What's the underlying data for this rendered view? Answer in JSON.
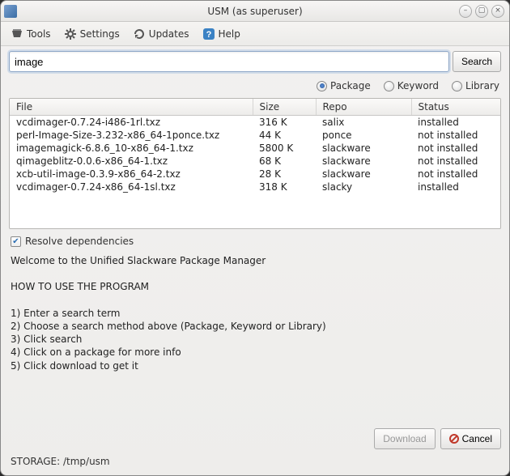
{
  "window": {
    "title": "USM (as superuser)"
  },
  "menubar": {
    "tools": "Tools",
    "settings": "Settings",
    "updates": "Updates",
    "help": "Help"
  },
  "search": {
    "value": "image",
    "button": "Search"
  },
  "radios": {
    "package": "Package",
    "keyword": "Keyword",
    "library": "Library",
    "selected": "package"
  },
  "table": {
    "headers": {
      "file": "File",
      "size": "Size",
      "repo": "Repo",
      "status": "Status"
    },
    "rows": [
      {
        "file": "vcdimager-0.7.24-i486-1rl.txz",
        "size": "316 K",
        "repo": "salix",
        "status": "installed"
      },
      {
        "file": "perl-Image-Size-3.232-x86_64-1ponce.txz",
        "size": "44 K",
        "repo": "ponce",
        "status": "not installed"
      },
      {
        "file": "imagemagick-6.8.6_10-x86_64-1.txz",
        "size": "5800 K",
        "repo": "slackware",
        "status": "not installed"
      },
      {
        "file": "qimageblitz-0.0.6-x86_64-1.txz",
        "size": "68 K",
        "repo": "slackware",
        "status": "not installed"
      },
      {
        "file": "xcb-util-image-0.3.9-x86_64-2.txz",
        "size": "28 K",
        "repo": "slackware",
        "status": "not installed"
      },
      {
        "file": "vcdimager-0.7.24-x86_64-1sl.txz",
        "size": "318 K",
        "repo": "slacky",
        "status": "installed"
      }
    ]
  },
  "resolve_deps": {
    "label": "Resolve dependencies",
    "checked": true
  },
  "info": {
    "text": "Welcome to the Unified Slackware Package Manager\n\nHOW TO USE THE PROGRAM\n\n1) Enter a search term\n2) Choose a search method above (Package, Keyword or Library)\n3) Click search\n4) Click on a package for more info\n5) Click download to get it"
  },
  "buttons": {
    "download": "Download",
    "cancel": "Cancel"
  },
  "status": {
    "text": "STORAGE: /tmp/usm"
  }
}
